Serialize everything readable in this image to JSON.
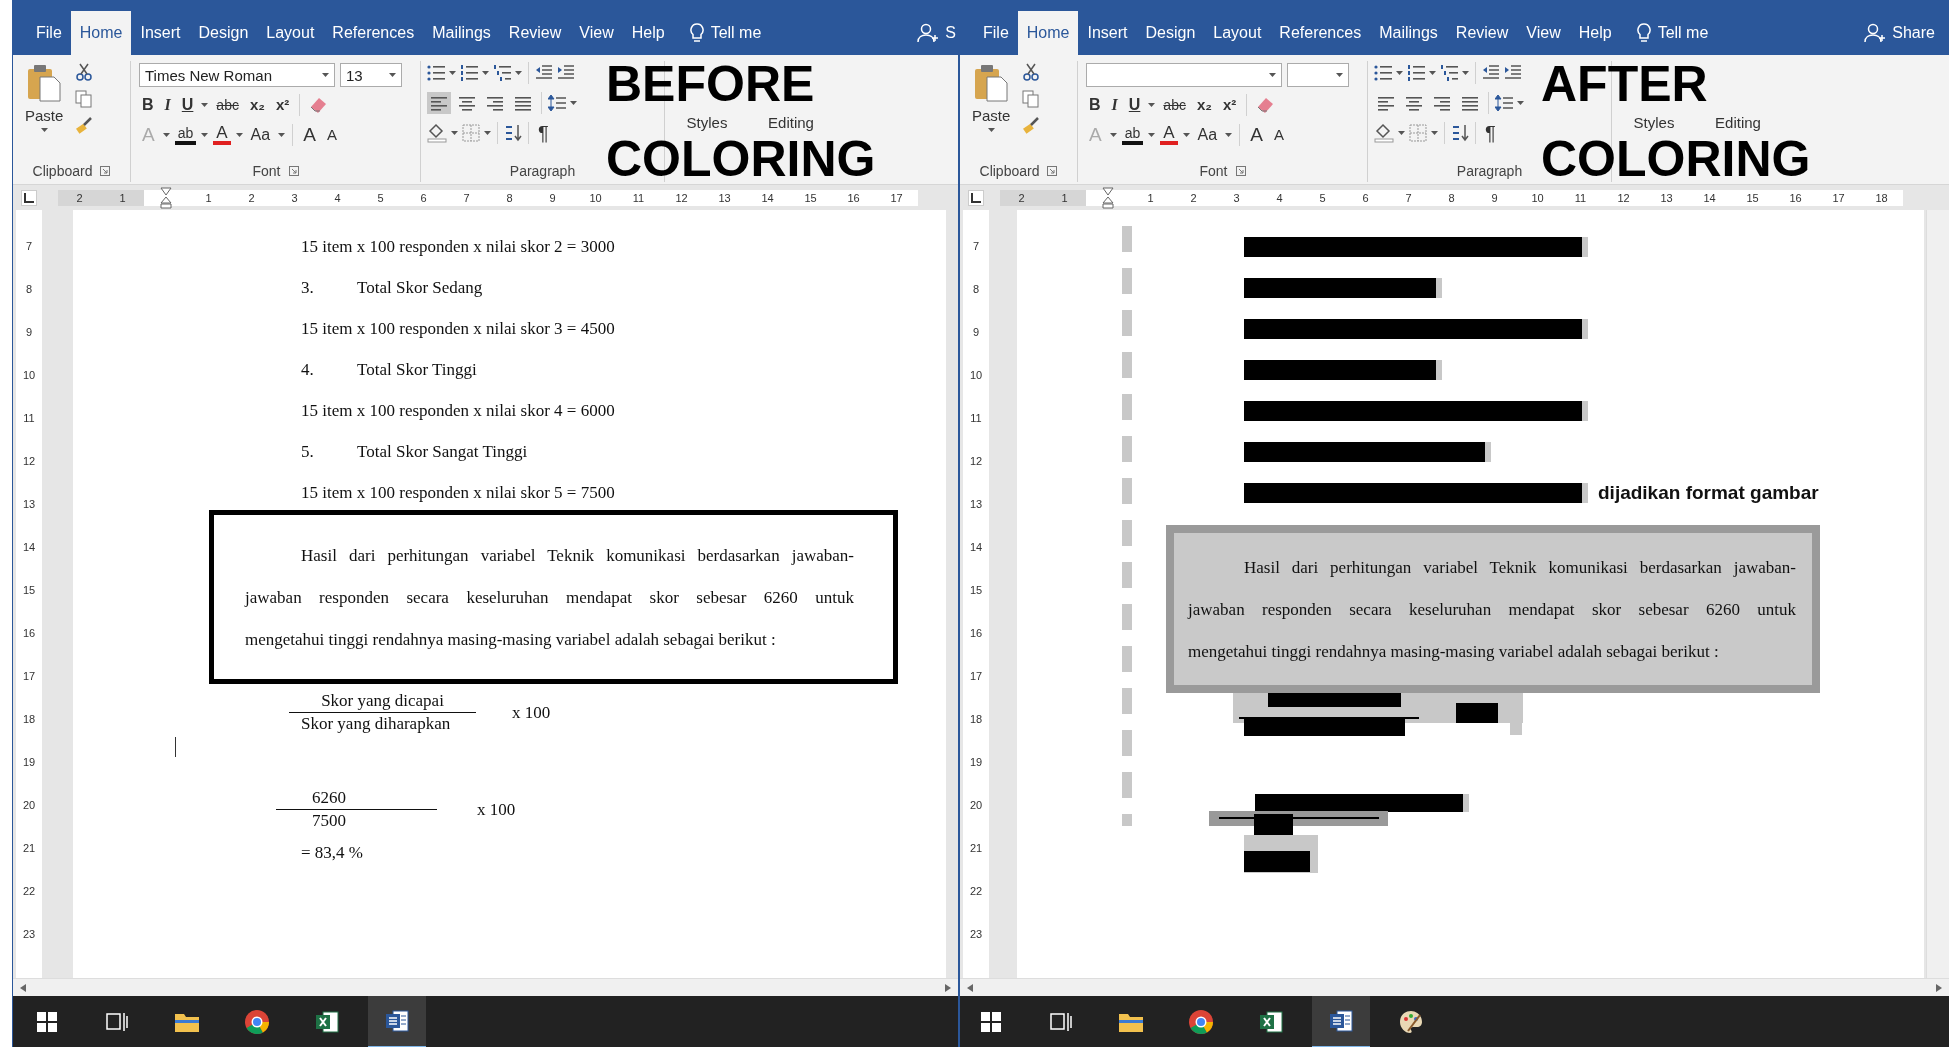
{
  "windows": [
    {
      "tabs": [
        {
          "label": "File",
          "selected": false
        },
        {
          "label": "Home",
          "selected": true
        },
        {
          "label": "Insert",
          "selected": false
        },
        {
          "label": "Design",
          "selected": false
        },
        {
          "label": "Layout",
          "selected": false
        },
        {
          "label": "References",
          "selected": false
        },
        {
          "label": "Mailings",
          "selected": false
        },
        {
          "label": "Review",
          "selected": false
        },
        {
          "label": "View",
          "selected": false
        },
        {
          "label": "Help",
          "selected": false
        }
      ],
      "tell_me": "Tell me",
      "account": "S",
      "ribbon": {
        "paste": "Paste",
        "font_name": "Times New Roman",
        "font_size": "13",
        "format_buttons": [
          "B",
          "I",
          "U",
          "abc",
          "x₂",
          "x²"
        ],
        "font_buttons": [
          "A",
          "ab",
          "A",
          "Aa",
          "A",
          "A"
        ],
        "align_buttons": [
          {
            "selected": true
          },
          {
            "selected": false
          },
          {
            "selected": false
          },
          {
            "selected": false
          }
        ],
        "pilcrow": "¶",
        "styles": "Styles",
        "editing": "Editing",
        "groups": [
          "Clipboard",
          "Font",
          "Paragraph"
        ]
      },
      "ruler": {
        "before_indent": [
          "2",
          "1"
        ],
        "after_indent": [
          "1",
          "2",
          "3",
          "4",
          "5",
          "6",
          "7",
          "8",
          "9",
          "10",
          "11",
          "12",
          "13",
          "14",
          "15",
          "16",
          "17"
        ],
        "vertical": [
          "7",
          "8",
          "9",
          "10",
          "11",
          "12",
          "13",
          "14",
          "15",
          "16",
          "17",
          "18",
          "19",
          "20",
          "21",
          "22",
          "23"
        ]
      },
      "change_bar": false,
      "vertical_scrollbar": false,
      "document": [
        {
          "kind": "text",
          "text": "15 item x 100 responden x nilai skor 2 = 3000"
        },
        {
          "kind": "numbered",
          "number": "3.",
          "text": "Total Skor Sedang"
        },
        {
          "kind": "text",
          "text": "15 item x 100 responden x nilai skor 3 = 4500"
        },
        {
          "kind": "numbered",
          "number": "4.",
          "text": "Total Skor Tinggi"
        },
        {
          "kind": "text",
          "text": "15 item x 100 responden x nilai skor 4 = 6000"
        },
        {
          "kind": "numbered",
          "number": "5.",
          "text": "Total Skor Sangat Tinggi"
        },
        {
          "kind": "text",
          "text": "15 item x 100 responden x nilai skor 5 = 7500"
        },
        {
          "kind": "outlined_paragraph",
          "lines": [
            "Hasil dari perhitungan variabel Teknik komunikasi berdasarkan jawaban-",
            "jawaban responden secara keseluruhan mendapat skor sebesar 6260 untuk",
            "mengetahui tinggi rendahnya masing-masing variabel adalah sebagai berikut :"
          ]
        },
        {
          "kind": "fraction",
          "numerator": "Skor yang dicapai",
          "denominator": "Skor yang diharapkan",
          "factor": "x 100"
        },
        {
          "kind": "cursor"
        },
        {
          "kind": "fraction",
          "numerator": "6260",
          "denominator": "7500",
          "factor": "x 100"
        },
        {
          "kind": "text",
          "text": "= 83,4 %"
        }
      ],
      "annotation": [
        "BEFORE",
        "COLORING"
      ],
      "taskbar": [
        {
          "kind": "start",
          "selected": false
        },
        {
          "kind": "taskview",
          "selected": false
        },
        {
          "kind": "explorer",
          "selected": false
        },
        {
          "kind": "browser",
          "selected": false
        },
        {
          "kind": "spreadsheet",
          "selected": false
        },
        {
          "kind": "word",
          "selected": true
        }
      ]
    },
    {
      "tabs": [
        {
          "label": "File",
          "selected": false
        },
        {
          "label": "Home",
          "selected": true
        },
        {
          "label": "Insert",
          "selected": false
        },
        {
          "label": "Design",
          "selected": false
        },
        {
          "label": "Layout",
          "selected": false
        },
        {
          "label": "References",
          "selected": false
        },
        {
          "label": "Mailings",
          "selected": false
        },
        {
          "label": "Review",
          "selected": false
        },
        {
          "label": "View",
          "selected": false
        },
        {
          "label": "Help",
          "selected": false
        }
      ],
      "tell_me": "Tell me",
      "account": "Share",
      "ribbon": {
        "paste": "Paste",
        "format_buttons": [
          "B",
          "I",
          "U",
          "abc",
          "x₂",
          "x²"
        ],
        "font_buttons": [
          "A",
          "ab",
          "A",
          "Aa",
          "A",
          "A"
        ],
        "align_buttons": [
          {
            "selected": false
          },
          {
            "selected": false
          },
          {
            "selected": false
          },
          {
            "selected": false
          }
        ],
        "pilcrow": "¶",
        "styles": "Styles",
        "editing": "Editing",
        "groups": [
          "Clipboard",
          "Font",
          "Paragraph"
        ]
      },
      "ruler": {
        "before_indent": [
          "2",
          "1"
        ],
        "after_indent": [
          "1",
          "2",
          "3",
          "4",
          "5",
          "6",
          "7",
          "8",
          "9",
          "10",
          "11",
          "12",
          "13",
          "14",
          "15",
          "16",
          "17",
          "18"
        ],
        "vertical": [
          "7",
          "8",
          "9",
          "10",
          "11",
          "12",
          "13",
          "14",
          "15",
          "16",
          "17",
          "18",
          "19",
          "20",
          "21",
          "22",
          "23"
        ]
      },
      "change_bar": true,
      "vertical_scrollbar": true,
      "document": [
        {
          "kind": "bar"
        },
        {
          "kind": "bar"
        },
        {
          "kind": "bar"
        },
        {
          "kind": "bar"
        },
        {
          "kind": "bar"
        },
        {
          "kind": "bar"
        },
        {
          "kind": "bar",
          "note": "dijadikan format gambar"
        },
        {
          "kind": "shaded_paragraph",
          "lines": [
            "Hasil dari perhitungan variabel Teknik komunikasi berdasarkan jawaban-",
            "jawaban responden secara keseluruhan mendapat skor sebesar 6260 untuk",
            "mengetahui tinggi rendahnya masing-masing variabel adalah sebagai berikut :"
          ]
        },
        {
          "kind": "scribble"
        }
      ],
      "annotation": [
        "AFTER",
        "COLORING"
      ],
      "taskbar": [
        {
          "kind": "start",
          "selected": false
        },
        {
          "kind": "taskview",
          "selected": false
        },
        {
          "kind": "explorer",
          "selected": false
        },
        {
          "kind": "browser",
          "selected": false
        },
        {
          "kind": "spreadsheet",
          "selected": false
        },
        {
          "kind": "word",
          "selected": true
        },
        {
          "kind": "paint",
          "selected": false
        }
      ]
    }
  ]
}
